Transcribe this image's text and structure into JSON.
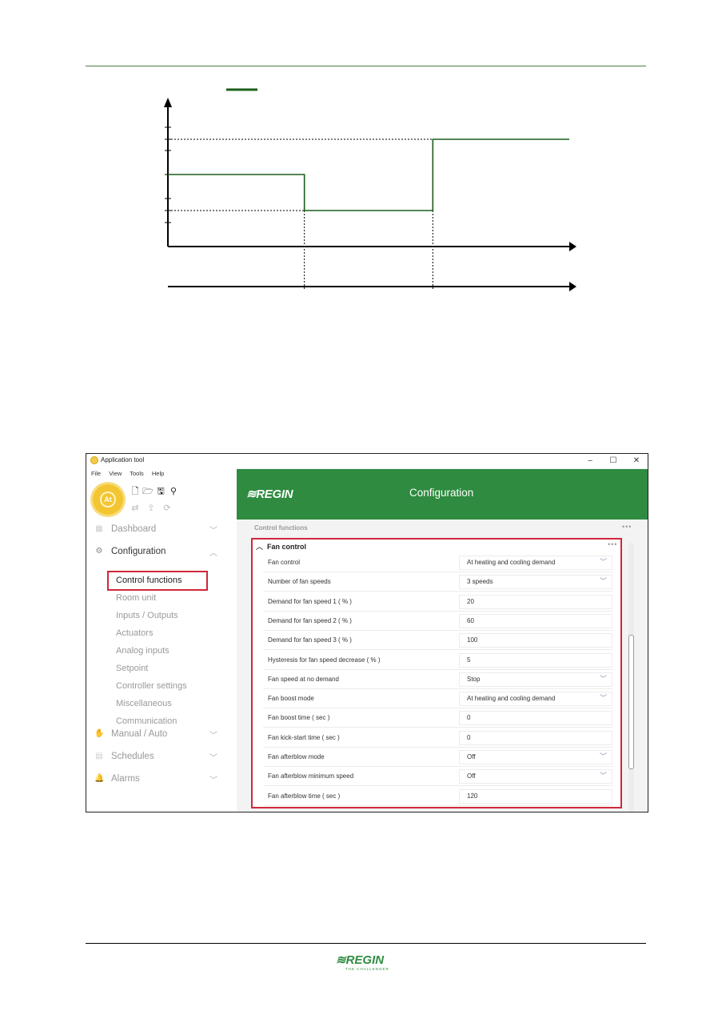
{
  "document": {
    "footer_brand": "≋REGIN",
    "footer_tagline": "THE CHALLENGER"
  },
  "diagram": {
    "description": "Fan speed step diagram with hysteresis (unlabelled)",
    "legend_color": "#1a5e1a",
    "levels_relative": {
      "start": 0.5,
      "middle": 0.25,
      "end": 0.75
    },
    "transitions_relative": [
      0.34,
      0.66
    ]
  },
  "app": {
    "window_title": "Application tool",
    "window_controls": {
      "minimize": "–",
      "maximize": "☐",
      "close": "✕"
    },
    "menu": [
      "File",
      "View",
      "Tools",
      "Help"
    ],
    "logo_text": "At",
    "toolbar": [
      {
        "name": "new-file-icon",
        "glyph": "🗋"
      },
      {
        "name": "open-folder-icon",
        "glyph": "🗁"
      },
      {
        "name": "save-icon",
        "glyph": "🖫"
      },
      {
        "name": "search-icon",
        "glyph": "⚲"
      }
    ],
    "toolbar_secondary": [
      {
        "name": "connect-icon",
        "glyph": "⇄"
      },
      {
        "name": "upload-icon",
        "glyph": "⇪"
      },
      {
        "name": "refresh-icon",
        "glyph": "⟳"
      }
    ],
    "header": {
      "brand": "≋REGIN",
      "title": "Configuration",
      "color": "#2e8b3f"
    },
    "sidebar": {
      "groups": [
        {
          "label": "Dashboard",
          "icon": "dashboard-icon",
          "glyph": "▦",
          "expanded": false
        },
        {
          "label": "Configuration",
          "icon": "gear-icon",
          "glyph": "⚙",
          "expanded": true
        },
        {
          "label": "Manual / Auto",
          "icon": "hand-icon",
          "glyph": "✋",
          "expanded": false
        },
        {
          "label": "Schedules",
          "icon": "calendar-icon",
          "glyph": "▤",
          "expanded": false
        },
        {
          "label": "Alarms",
          "icon": "bell-icon",
          "glyph": "🔔",
          "expanded": false
        }
      ],
      "config_items": [
        "Control functions",
        "Room unit",
        "Inputs / Outputs",
        "Actuators",
        "Analog inputs",
        "Setpoint",
        "Controller settings",
        "Miscellaneous",
        "Communication"
      ],
      "active_item": "Control functions"
    },
    "breadcrumb": "Control functions",
    "section": {
      "title": "Fan control",
      "rows": [
        {
          "label": "Fan control",
          "type": "select",
          "value": "At heating and cooling demand"
        },
        {
          "label": "Number of fan speeds",
          "type": "select",
          "value": "3 speeds"
        },
        {
          "label": "Demand for fan speed 1 ( % )",
          "type": "input",
          "value": "20"
        },
        {
          "label": "Demand for fan speed 2 ( % )",
          "type": "input",
          "value": "60"
        },
        {
          "label": "Demand for fan speed 3 ( % )",
          "type": "input",
          "value": "100"
        },
        {
          "label": "Hysteresis for fan speed decrease ( % )",
          "type": "input",
          "value": "5"
        },
        {
          "label": "Fan speed at no demand",
          "type": "select",
          "value": "Stop"
        },
        {
          "label": "Fan boost mode",
          "type": "select",
          "value": "At heating and cooling demand"
        },
        {
          "label": "Fan boost time ( sec )",
          "type": "input",
          "value": "0"
        },
        {
          "label": "Fan kick-start time ( sec )",
          "type": "input",
          "value": "0"
        },
        {
          "label": "Fan afterblow mode",
          "type": "select",
          "value": "Off"
        },
        {
          "label": "Fan afterblow minimum speed",
          "type": "select",
          "value": "Off"
        },
        {
          "label": "Fan afterblow time ( sec )",
          "type": "input",
          "value": "120"
        }
      ]
    },
    "highlight_color": "#d0283a"
  }
}
